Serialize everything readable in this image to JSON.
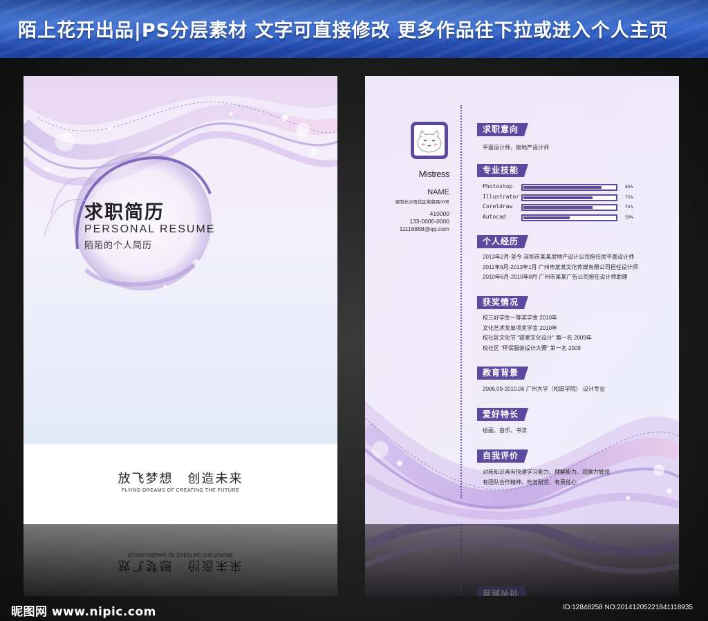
{
  "banner": {
    "text": "陌上花开出品|PS分层素材 文字可直接修改  更多作品往下拉或进入个人主页"
  },
  "cover": {
    "title_cn": "求职简历",
    "title_en": "PERSONAL RESUME",
    "subtitle": "陌陌的个人简历",
    "slogan_cn": "放飞梦想  创造未来",
    "slogan_en": "FLYING DREAMS OF CREATING THE FUTURE"
  },
  "profile": {
    "name": "Mistress",
    "name_label": "NAME",
    "address": "湖南长沙雨花区芙蓉路00号",
    "zip": "410000",
    "phone": "133-0000-0000",
    "email": "11118888@qq.com"
  },
  "sections": {
    "job": {
      "title": "求职意向",
      "text": "平面设计师，房地产设计师"
    },
    "skills": {
      "title": "专业技能",
      "items": [
        {
          "name": "Photoshop",
          "pct": "85%",
          "level": 0.85
        },
        {
          "name": "Illustrator",
          "pct": "75%",
          "level": 0.75
        },
        {
          "name": "Coreldraw",
          "pct": "75%",
          "level": 0.75
        },
        {
          "name": "Autocad",
          "pct": "50%",
          "level": 0.5
        }
      ]
    },
    "experience": {
      "title": "个人经历",
      "lines": [
        "2013年2月-至今  深圳市某某房地产设计公司担任房平面设计师",
        "2011年9月-2013年1月  广州市某某文化传媒有限公司担任设计师",
        "2010年6月-2010年8月  广州市某某广告公司担任设计师助理"
      ]
    },
    "awards": {
      "title": "获奖情况",
      "lines": [
        "校三好学生一等奖学金   2010年",
        "文化艺术奖单项奖学金   2010年",
        "校社区文化节 “寝室文化设计” 第一名 2009年",
        "校社区 “环保服装设计大赛” 第一名 2009"
      ]
    },
    "education": {
      "title": "教育背景",
      "text": "2006.09-2010.06  广州大学（松田学院） 设计专业"
    },
    "hobbies": {
      "title": "爱好特长",
      "text": "绘画、音乐、书法"
    },
    "self": {
      "title": "自我评价",
      "lines": [
        "对新知识具有快速学习能力、理解能力、观察力敏锐",
        "有团队合作精神、吃苦耐劳、有责任心"
      ]
    }
  },
  "reflection": {
    "right_title": "自我评价"
  },
  "footer": {
    "watermark": "昵图网 www.nipic.com",
    "id_text": "ID:12848258 NO:20141205221841118935"
  },
  "colors": {
    "accent": "#5b4a9e",
    "banner": "#2c5ec9"
  }
}
